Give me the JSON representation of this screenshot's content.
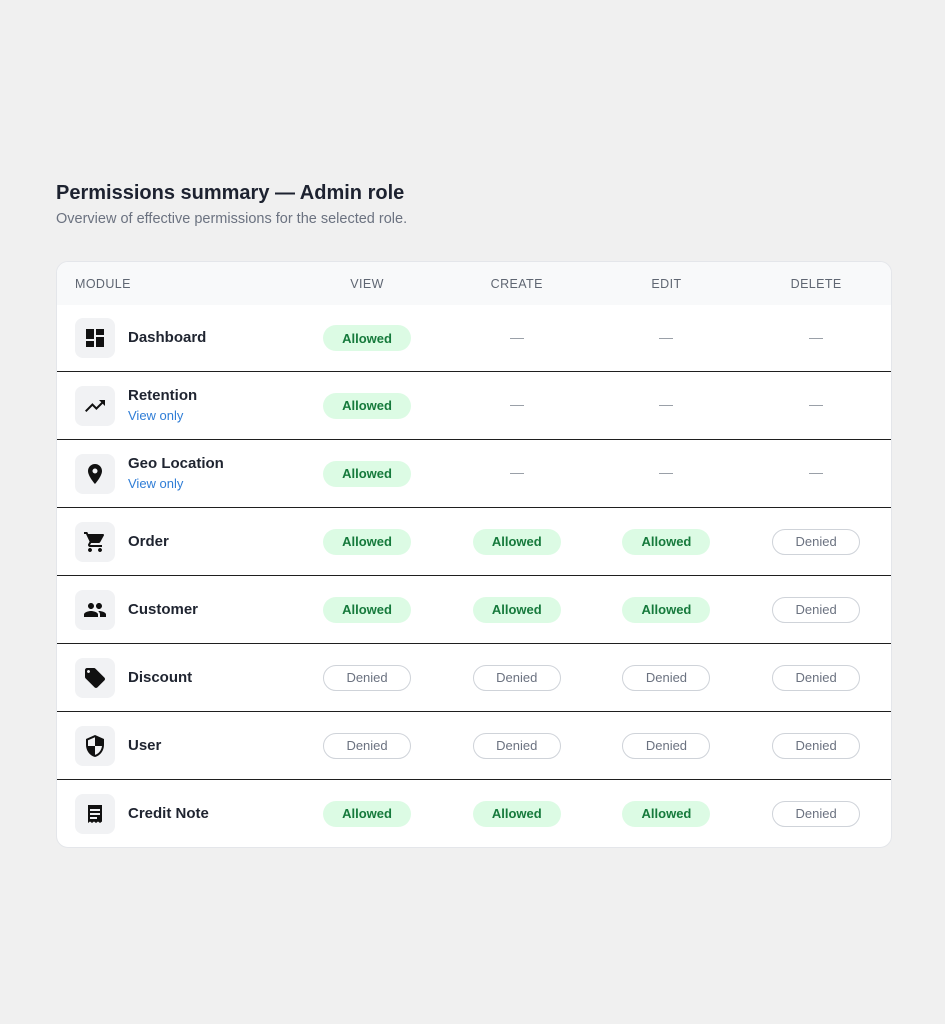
{
  "header": {
    "title": "Permissions summary — Admin role",
    "subtitle": "Overview of effective permissions for the selected role."
  },
  "table": {
    "columns": [
      "MODULE",
      "VIEW",
      "CREATE",
      "EDIT",
      "DELETE"
    ],
    "rows": [
      {
        "module": "Dashboard",
        "sub": "",
        "icon": "dashboard-icon",
        "view": "Allowed",
        "create": "—",
        "edit": "—",
        "delete": "—"
      },
      {
        "module": "Retention",
        "sub": "View only",
        "icon": "trending-up-icon",
        "view": "Allowed",
        "create": "—",
        "edit": "—",
        "delete": "—"
      },
      {
        "module": "Geo Location",
        "sub": "View only",
        "icon": "location-pin-icon",
        "view": "Allowed",
        "create": "—",
        "edit": "—",
        "delete": "—"
      },
      {
        "module": "Order",
        "sub": "",
        "icon": "shopping-cart-icon",
        "view": "Allowed",
        "create": "Allowed",
        "edit": "Allowed",
        "delete": "Denied"
      },
      {
        "module": "Customer",
        "sub": "",
        "icon": "people-icon",
        "view": "Allowed",
        "create": "Allowed",
        "edit": "Allowed",
        "delete": "Denied"
      },
      {
        "module": "Discount",
        "sub": "",
        "icon": "tag-icon",
        "view": "Denied",
        "create": "Denied",
        "edit": "Denied",
        "delete": "Denied"
      },
      {
        "module": "User",
        "sub": "",
        "icon": "shield-icon",
        "view": "Denied",
        "create": "Denied",
        "edit": "Denied",
        "delete": "Denied"
      },
      {
        "module": "Credit Note",
        "sub": "",
        "icon": "receipt-icon",
        "view": "Allowed",
        "create": "Allowed",
        "edit": "Allowed",
        "delete": "Denied"
      }
    ]
  },
  "colors": {
    "allowed_bg": "#dcfbe4",
    "allowed_text": "#167a3c",
    "denied_border": "#cfd3d9",
    "link": "#2f7dd6"
  }
}
